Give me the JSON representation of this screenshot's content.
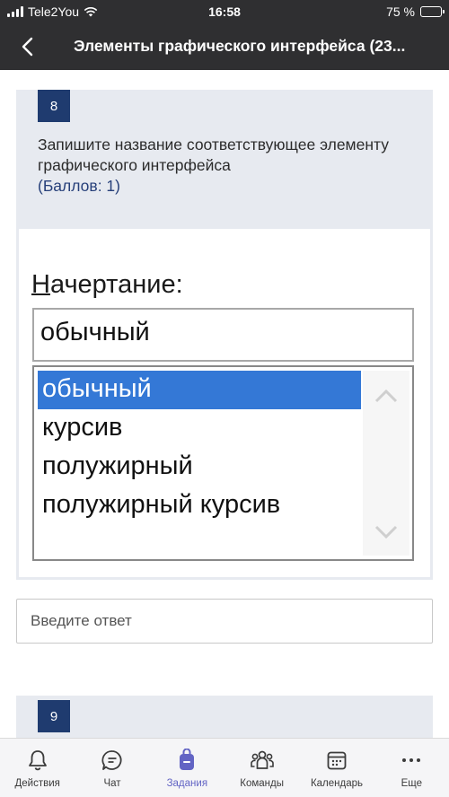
{
  "status_bar": {
    "carrier": "Tele2You",
    "time": "16:58",
    "battery_text": "75 %",
    "battery_level": 0.75
  },
  "header": {
    "title": "Элементы графического интерфейса (23..."
  },
  "question": {
    "number": "8",
    "text": "Запишите название соответствующее элементу графического интерфейса",
    "points": "(Баллов: 1)"
  },
  "image": {
    "label_first_letter": "Н",
    "label_rest": "ачертание:",
    "combo_value": "обычный",
    "list_items": [
      "обычный",
      "курсив",
      "полужирный",
      "полужирный курсив"
    ],
    "selected_index": 0
  },
  "answer": {
    "placeholder": "Введите ответ"
  },
  "next_question": {
    "number": "9"
  },
  "tabs": [
    {
      "label": "Действия",
      "icon": "bell-icon"
    },
    {
      "label": "Чат",
      "icon": "chat-icon"
    },
    {
      "label": "Задания",
      "icon": "backpack-icon",
      "active": true
    },
    {
      "label": "Команды",
      "icon": "teams-icon"
    },
    {
      "label": "Календарь",
      "icon": "calendar-icon"
    },
    {
      "label": "Еще",
      "icon": "more-icon"
    }
  ],
  "colors": {
    "header_bg": "#2f2f31",
    "accent": "#6264c4",
    "question_badge": "#1f3b6f",
    "selection": "#3478d6"
  }
}
